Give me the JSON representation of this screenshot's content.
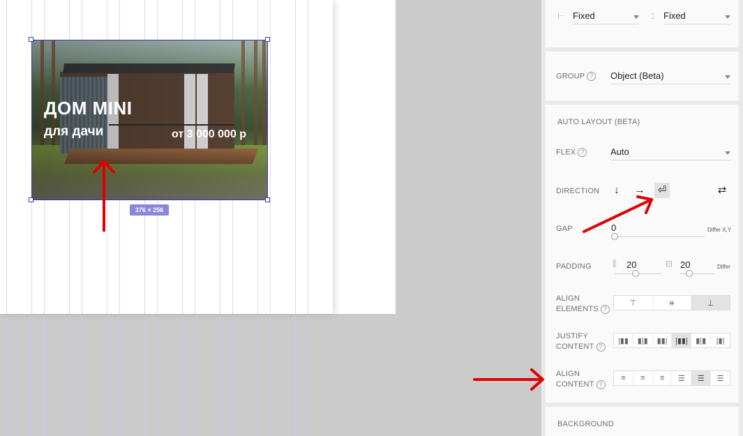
{
  "canvas": {
    "hero": {
      "title": "ДОМ MINI",
      "subtitle": "для дачи",
      "price": "от 3 000 000 р"
    },
    "size_badge": "376 × 256"
  },
  "panel": {
    "size_row": {
      "width_mode": "Fixed",
      "height_mode": "Fixed",
      "width_icon": "width-resize-icon",
      "height_icon": "height-resize-icon"
    },
    "group": {
      "label": "GROUP",
      "value": "Object (Beta)"
    },
    "auto_layout": {
      "title": "AUTO LAYOUT (BETA)",
      "flex_label": "FLEX",
      "flex_value": "Auto",
      "direction_label": "DIRECTION",
      "direction_options": [
        "↓",
        "→",
        "⏎",
        "⇄"
      ],
      "direction_selected": "wrap",
      "gap_label": "GAP",
      "gap_value": "0",
      "gap_hint": "Differ X,Y",
      "padding_label": "PADDING",
      "padding_vertical": "20",
      "padding_horizontal": "20",
      "padding_hint": "Differ",
      "align_elements_label_1": "ALIGN",
      "align_elements_label_2": "ELEMENTS",
      "align_elements_options": [
        "top",
        "center",
        "bottom"
      ],
      "align_elements_selected": "bottom",
      "justify_label_1": "JUSTIFY",
      "justify_label_2": "CONTENT",
      "justify_options": [
        "start",
        "center",
        "end",
        "space-between",
        "space-around",
        "space-evenly"
      ],
      "justify_selected": "space-between",
      "align_content_label_1": "ALIGN",
      "align_content_label_2": "CONTENT",
      "align_content_options": [
        "start",
        "center",
        "end",
        "space-between",
        "space-around",
        "stretch"
      ],
      "align_content_selected": "space-around"
    },
    "background": {
      "label": "BACKGROUND"
    }
  },
  "help_glyph": "?",
  "colors": {
    "selection": "#3838b8",
    "badge": "#8a87d9",
    "annotation": "#e00000",
    "panel_bg": "#e9e9e9",
    "canvas_bg": "#cbcbcb"
  }
}
